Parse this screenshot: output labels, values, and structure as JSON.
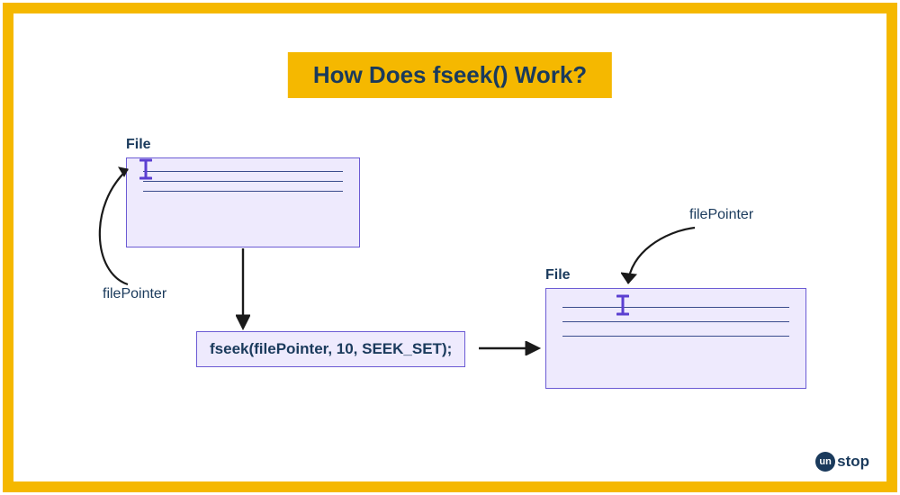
{
  "title": "How Does fseek() Work?",
  "file1": {
    "label": "File",
    "pointer_label": "filePointer"
  },
  "file2": {
    "label": "File",
    "pointer_label": "filePointer"
  },
  "code": "fseek(filePointer, 10, SEEK_SET);",
  "logo": {
    "circle": "un",
    "rest": "stop"
  }
}
